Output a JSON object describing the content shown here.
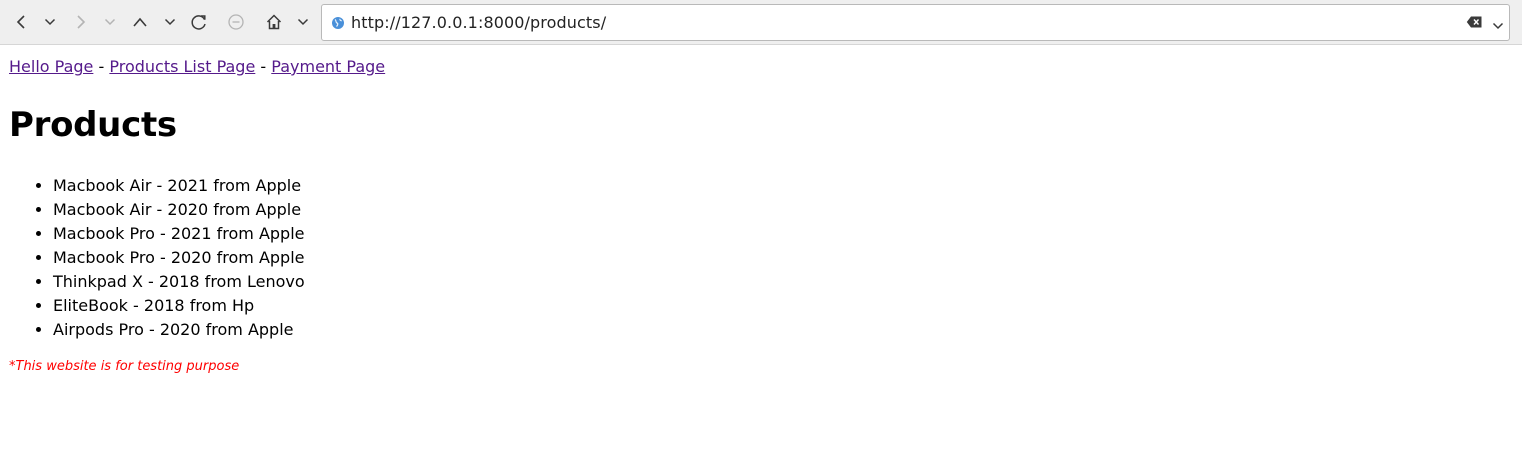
{
  "browser": {
    "url": "http://127.0.0.1:8000/products/",
    "icons": [
      "back-icon",
      "back-history-icon",
      "forward-icon",
      "forward-history-icon",
      "scroll-up-icon",
      "scroll-down-icon",
      "reload-icon",
      "stop-icon",
      "home-icon",
      "home-menu-icon",
      "globe-icon",
      "clear-icon",
      "dropdown-icon"
    ]
  },
  "nav": {
    "links": [
      "Hello Page",
      "Products List Page",
      "Payment Page"
    ],
    "separator": "-",
    "link_color": "#551a8b"
  },
  "page": {
    "title": "Products",
    "products": [
      "Macbook Air - 2021 from Apple",
      "Macbook Air - 2020 from Apple",
      "Macbook Pro - 2021 from Apple",
      "Macbook Pro - 2020 from Apple",
      "Thinkpad X - 2018 from Lenovo",
      "EliteBook - 2018 from Hp",
      "Airpods Pro - 2020 from Apple"
    ],
    "note": "*This website is for testing purpose",
    "note_color": "#ff0000"
  }
}
